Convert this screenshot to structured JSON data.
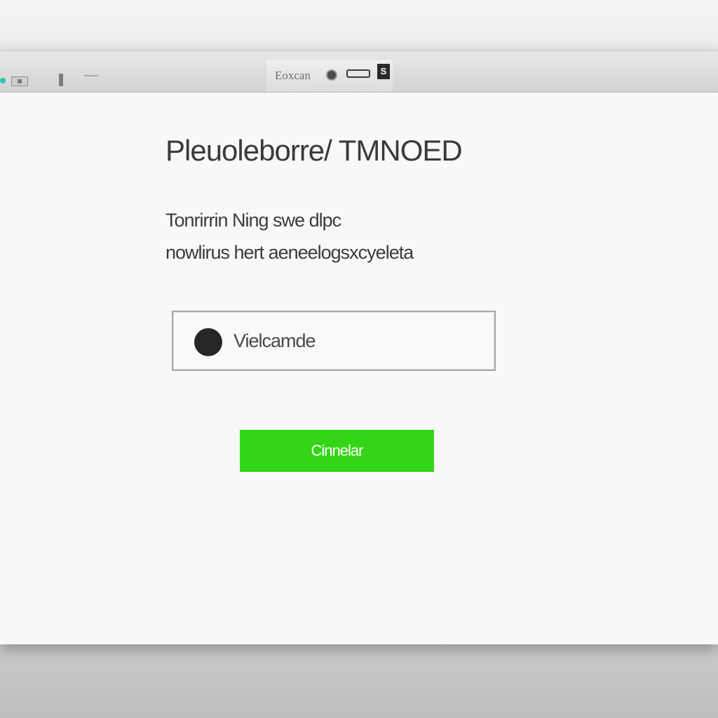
{
  "toolbar": {
    "search_label": "Eoxcan",
    "badge_glyph": "S"
  },
  "dialog": {
    "title": "Pleuoleborre/ TMNOED",
    "description_lines": [
      "Tonrirrin Ning swe dlpc",
      "nowlirus hert aeneelogsxcyeleta"
    ],
    "option": {
      "label": "Vielcamde",
      "selected": true
    },
    "primary_button_label": "Cinnelar"
  },
  "colors": {
    "primary_button": "#33d616",
    "accent_dot": "#2ec4b6"
  }
}
